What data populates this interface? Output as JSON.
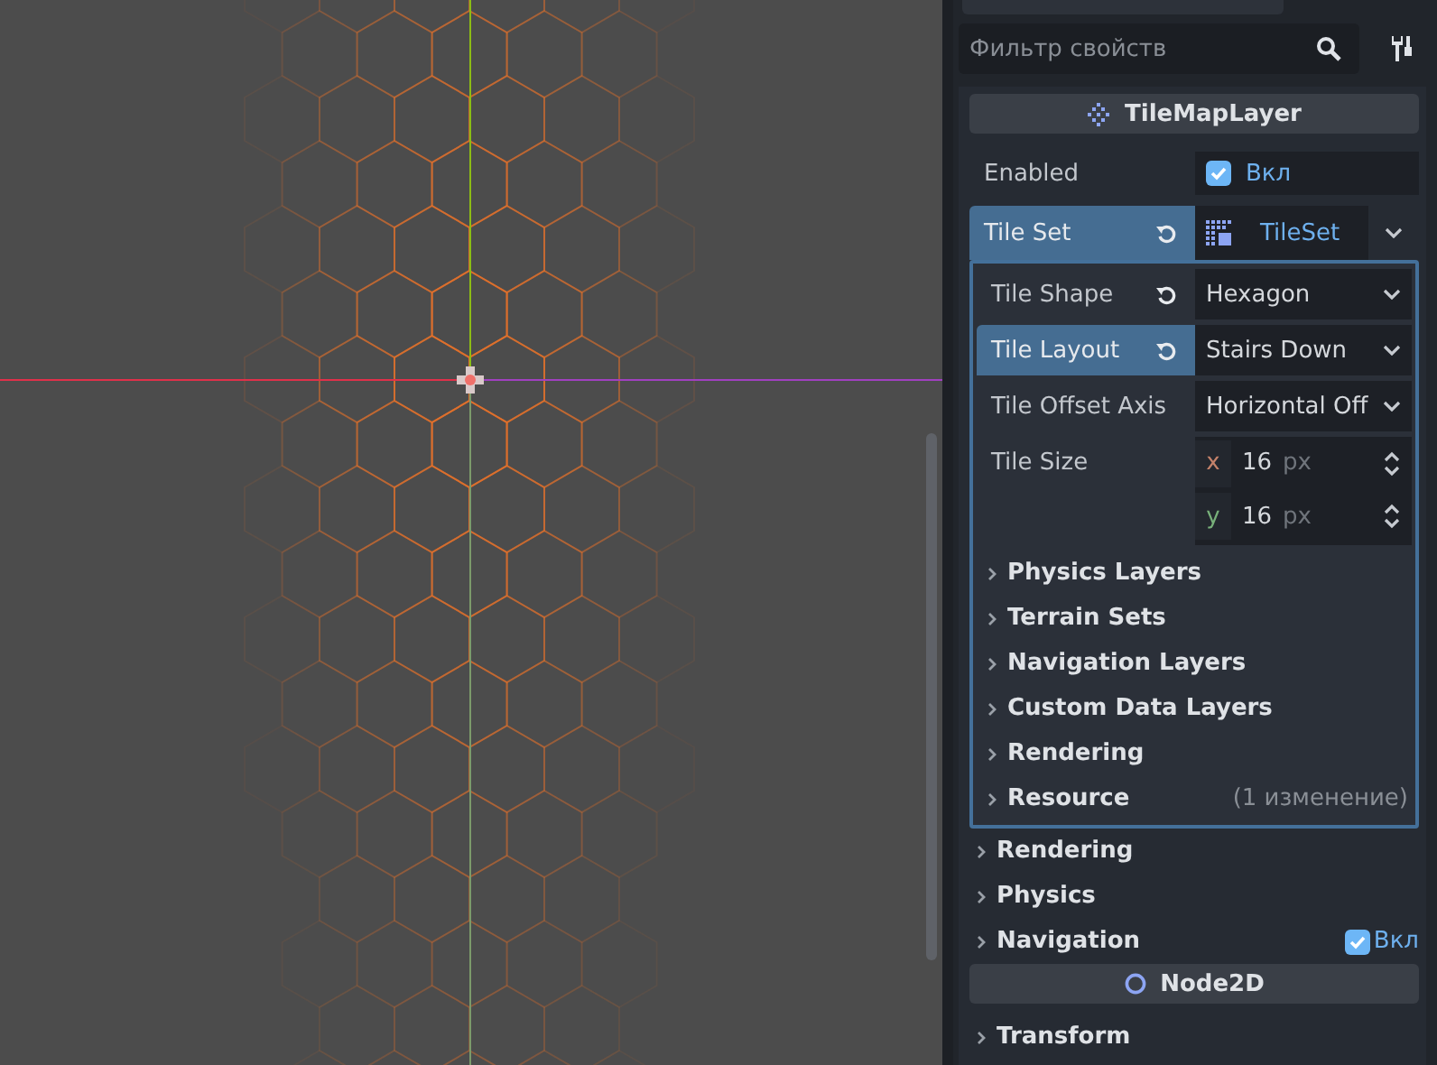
{
  "filter": {
    "placeholder": "Фильтр свойств"
  },
  "sections": [
    {
      "title": "TileMapLayer",
      "properties": [
        {
          "label": "Enabled",
          "kind": "check",
          "checked": true,
          "value": "Вкл",
          "selected": false,
          "revertable": false
        },
        {
          "label": "Tile Set",
          "kind": "resource",
          "value": "TileSet",
          "selected": true,
          "revertable": true,
          "expanded": true,
          "sub_properties": [
            {
              "label": "Tile Shape",
              "kind": "enum",
              "value": "Hexagon",
              "selected": false,
              "revertable": true
            },
            {
              "label": "Tile Layout",
              "kind": "enum",
              "value": "Stairs Down",
              "selected": true,
              "revertable": true
            },
            {
              "label": "Tile Offset Axis",
              "kind": "enum",
              "value": "Horizontal Off",
              "selected": false,
              "revertable": false
            },
            {
              "label": "Tile Size",
              "kind": "vector",
              "selected": false,
              "revertable": false,
              "components": [
                {
                  "axis": "x",
                  "value": "16",
                  "unit": "px"
                },
                {
                  "axis": "y",
                  "value": "16",
                  "unit": "px"
                }
              ]
            }
          ],
          "groups": [
            {
              "label": "Physics Layers"
            },
            {
              "label": "Terrain Sets"
            },
            {
              "label": "Navigation Layers"
            },
            {
              "label": "Custom Data Layers"
            },
            {
              "label": "Rendering"
            },
            {
              "label": "Resource",
              "note": "(1 изменение)"
            }
          ]
        }
      ],
      "groups": [
        {
          "label": "Rendering"
        },
        {
          "label": "Physics"
        },
        {
          "label": "Navigation",
          "checked": true,
          "value": "Вкл"
        }
      ]
    },
    {
      "title": "Node2D",
      "groups": [
        {
          "label": "Transform"
        }
      ]
    }
  ]
}
